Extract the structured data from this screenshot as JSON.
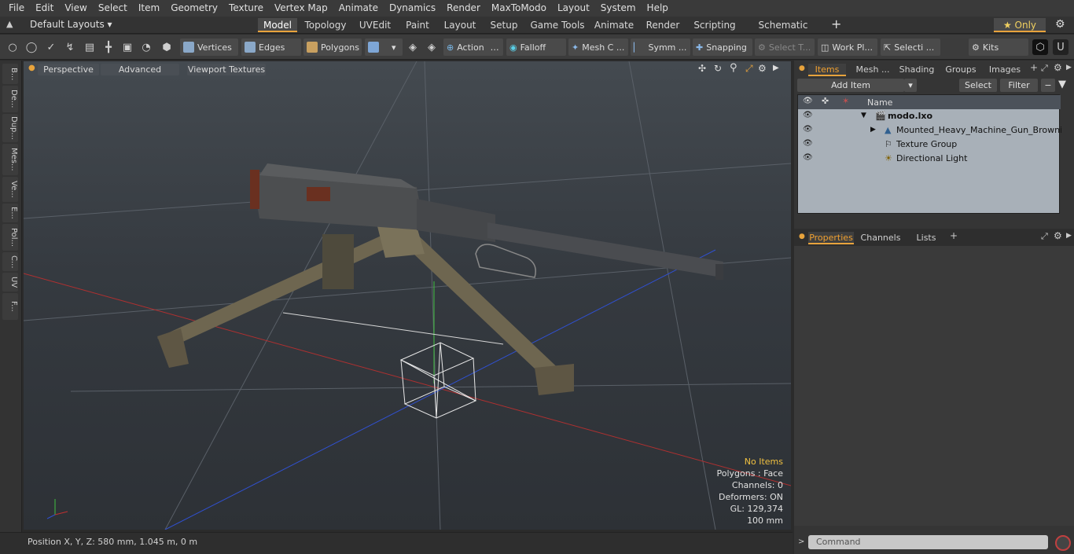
{
  "menu": [
    "File",
    "Edit",
    "View",
    "Select",
    "Item",
    "Geometry",
    "Texture",
    "Vertex Map",
    "Animate",
    "Dynamics",
    "Render",
    "MaxToModo",
    "Layout",
    "System",
    "Help"
  ],
  "layout_selector": "Default Layouts ▾",
  "layout_tabs": [
    "Model",
    "Topology",
    "UVEdit",
    "Paint",
    "Layout",
    "Setup",
    "Game Tools",
    "Animate",
    "Render",
    "Scripting",
    "Schematic Fusion"
  ],
  "only_label": "★ Only",
  "toolbar": {
    "vertices": "Vertices",
    "edges": "Edges",
    "polygons": "Polygons",
    "action": "Action",
    "falloff": "Falloff",
    "mesh": "Mesh C ...",
    "symm": "Symm ...",
    "snapping": "Snapping",
    "select_t": "Select T...",
    "work_pl": "Work Pl...",
    "selecti": "Selecti ...",
    "kits": "Kits"
  },
  "left_tabs": [
    "B...",
    "De...",
    "Dup...",
    "Mes...",
    "Ve...",
    "E...",
    "Pol...",
    "C...",
    "UV",
    "F..."
  ],
  "viewport": {
    "perspective": "Perspective",
    "advanced": "Advanced",
    "viewport_textures": "Viewport Textures"
  },
  "hud": {
    "no_items": "No Items",
    "polygons": "Polygons : Face",
    "channels": "Channels: 0",
    "deformers": "Deformers: ON",
    "gl": "GL: 129,374",
    "scale": "100 mm"
  },
  "status": "Position X, Y, Z:   580 mm, 1.045 m, 0 m",
  "right_tabs": [
    "Items",
    "Mesh ...",
    "Shading",
    "Groups",
    "Images"
  ],
  "add_item": "Add Item",
  "select_btn": "Select",
  "filter_btn": "Filter",
  "name_col": "Name",
  "items": [
    {
      "label": "modo.lxo"
    },
    {
      "label": "Mounted_Heavy_Machine_Gun_Browning_..."
    },
    {
      "label": "Texture Group"
    },
    {
      "label": "Directional Light"
    }
  ],
  "prop_tabs": [
    "Properties",
    "Channels",
    "Lists"
  ],
  "command_placeholder": "Command",
  "colors": {
    "accent": "#e8a33c",
    "x_axis": "#c03030",
    "y_axis": "#40c040",
    "z_axis": "#3050d0"
  }
}
